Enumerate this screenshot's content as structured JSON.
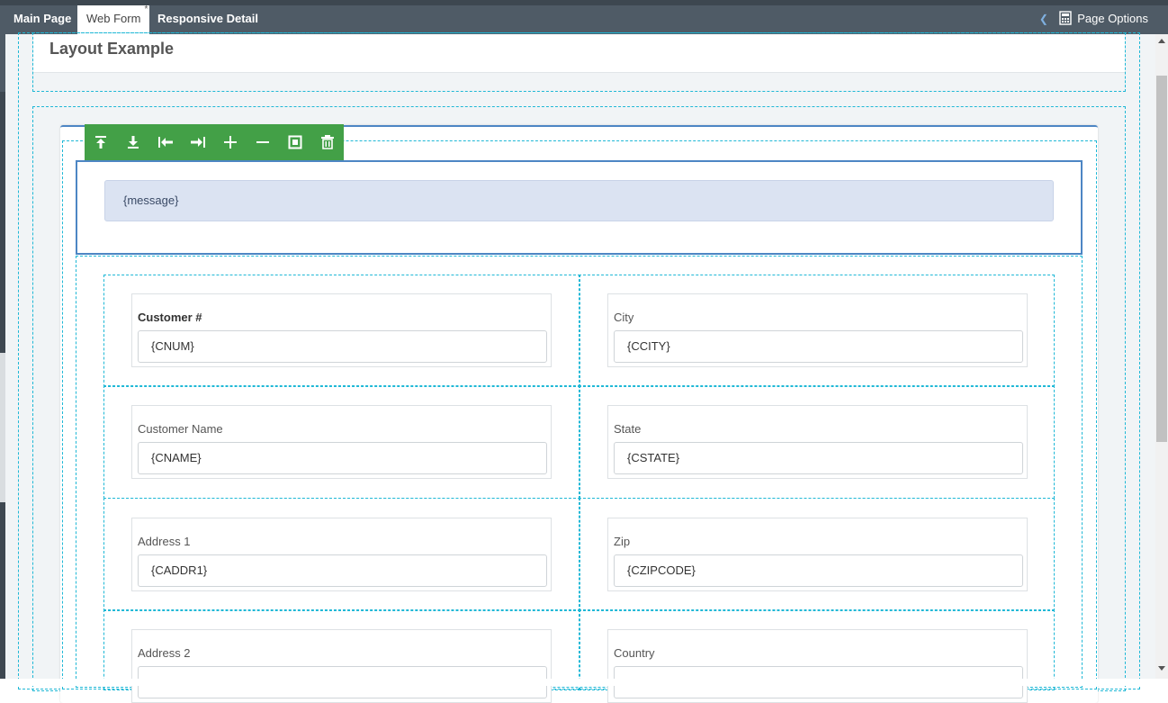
{
  "tabs": [
    {
      "label": "Main Page"
    },
    {
      "label": "Web Form",
      "modified_marker": "*"
    },
    {
      "label": "Responsive Detail"
    }
  ],
  "page_options": {
    "label": "Page Options",
    "icon": "calculator-icon"
  },
  "page": {
    "title": "Layout Example"
  },
  "toolbar": {
    "icons": [
      "move-top-icon",
      "move-bottom-icon",
      "move-left-icon",
      "move-right-icon",
      "add-icon",
      "remove-icon",
      "select-icon",
      "delete-icon"
    ],
    "color": "#43a047"
  },
  "message": {
    "value": "{message}"
  },
  "fields": [
    {
      "label": "Customer #",
      "value": "{CNUM}",
      "bold": true
    },
    {
      "label": "City",
      "value": "{CCITY}"
    },
    {
      "label": "Customer Name",
      "value": "{CNAME}"
    },
    {
      "label": "State",
      "value": "{CSTATE}"
    },
    {
      "label": "Address 1",
      "value": "{CADDR1}"
    },
    {
      "label": "Zip",
      "value": "{CZIPCODE}"
    },
    {
      "label": "Address 2",
      "value": ""
    },
    {
      "label": "Country",
      "value": ""
    }
  ],
  "colors": {
    "topbar": "#4f5b66",
    "accent_blue": "#4d86c4",
    "guide_dashed": "#1fb8d6",
    "message_bg": "#dbe3f2"
  }
}
